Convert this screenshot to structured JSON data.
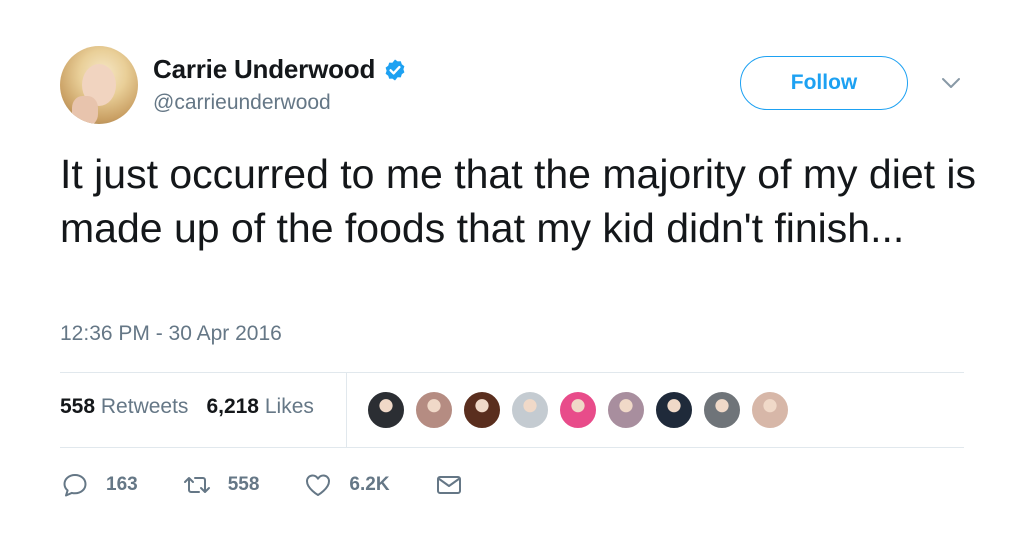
{
  "header": {
    "display_name": "Carrie Underwood",
    "handle": "@carrieunderwood",
    "follow_label": "Follow"
  },
  "tweet": {
    "text": "It just occurred to me that the majority of my diet is made up of the foods that my kid didn't finish...",
    "timestamp": "12:36 PM - 30 Apr 2016"
  },
  "stats": {
    "retweets_count": "558",
    "retweets_label": "Retweets",
    "likes_count": "6,218",
    "likes_label": "Likes"
  },
  "likers": [
    {
      "name": "liker-avatar-1",
      "color": "#2b2e33"
    },
    {
      "name": "liker-avatar-2",
      "color": "#b58c82"
    },
    {
      "name": "liker-avatar-3",
      "color": "#5a2e1e"
    },
    {
      "name": "liker-avatar-4",
      "color": "#c4cbd1"
    },
    {
      "name": "liker-avatar-5",
      "color": "#e84c8a"
    },
    {
      "name": "liker-avatar-6",
      "color": "#a88e9e"
    },
    {
      "name": "liker-avatar-7",
      "color": "#1f2a3a"
    },
    {
      "name": "liker-avatar-8",
      "color": "#6f7479"
    },
    {
      "name": "liker-avatar-9",
      "color": "#d7b7a8"
    }
  ],
  "actions": {
    "replies": "163",
    "retweets": "558",
    "likes": "6.2K"
  },
  "icons": {
    "reply": "reply-icon",
    "retweet": "retweet-icon",
    "like": "heart-icon",
    "message": "envelope-icon",
    "verified": "verified-badge-icon",
    "chevron": "chevron-down-icon"
  },
  "colors": {
    "accent": "#1da1f2",
    "text_primary": "#14171a",
    "text_secondary": "#657786",
    "divider": "#e1e8ed"
  }
}
